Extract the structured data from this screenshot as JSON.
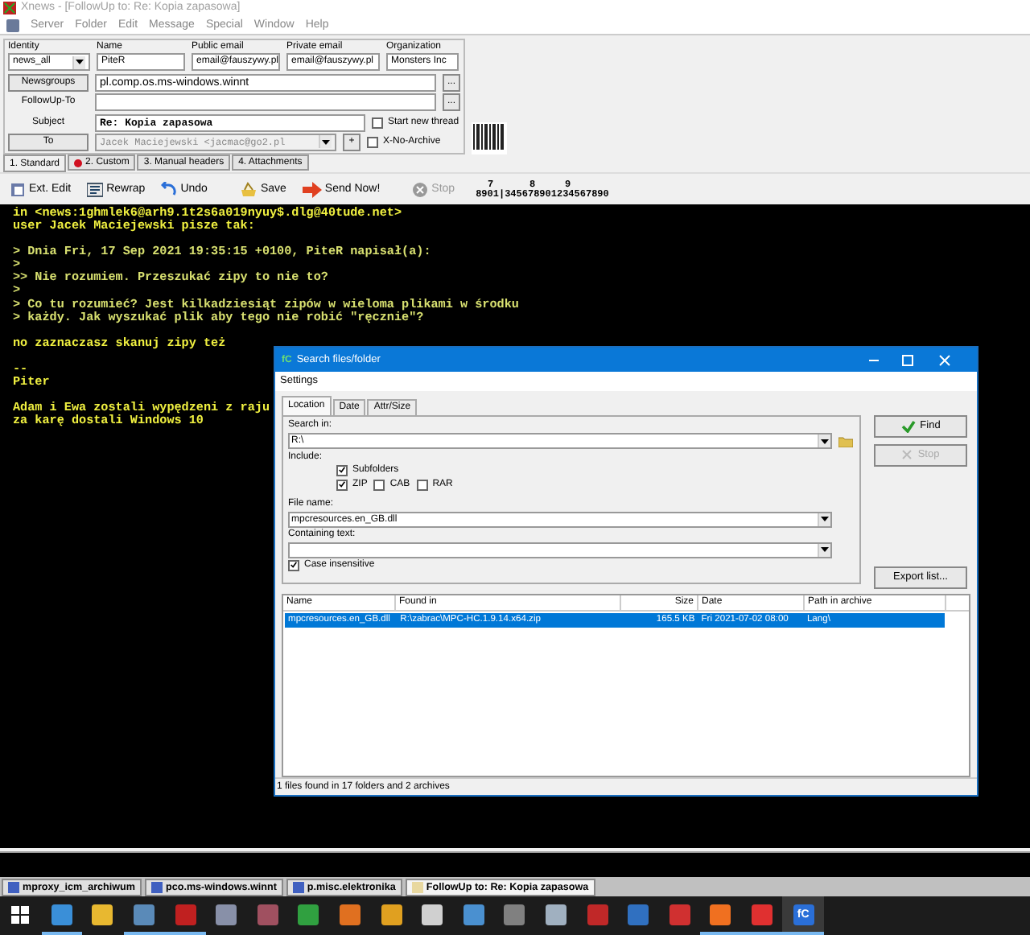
{
  "window": {
    "title": "Xnews - [FollowUp to: Re: Kopia zapasowa]"
  },
  "menu": [
    "Server",
    "Folder",
    "Edit",
    "Message",
    "Special",
    "Window",
    "Help"
  ],
  "header": {
    "labels": [
      "Identity",
      "Name",
      "Public email",
      "Private email",
      "Organization"
    ],
    "identity": "news_all",
    "name": "PiteR",
    "public_email": "email@fauszywy.pl",
    "private_email": "email@fauszywy.pl",
    "organization": "Monsters Inc",
    "newsgroups_button": "Newsgroups",
    "newsgroups": "pl.comp.os.ms-windows.winnt",
    "browse_button": "...",
    "followup_label": "FollowUp-To",
    "subject_label": "Subject",
    "subject": "Re: Kopia zapasowa",
    "to_button": "To",
    "to": "Jacek Maciejewski <jacmac@go2.pl",
    "add_button": "+",
    "options": [
      {
        "label": "Start new thread",
        "checked": false
      },
      {
        "label": "X-No-Archive",
        "checked": false
      }
    ]
  },
  "tabs": [
    {
      "label": "1. Standard",
      "selected": true,
      "dot": false
    },
    {
      "label": "2. Custom",
      "selected": false,
      "dot": true
    },
    {
      "label": "3. Manual headers",
      "selected": false,
      "dot": false
    },
    {
      "label": "4. Attachments",
      "selected": false,
      "dot": false
    }
  ],
  "toolbar": [
    {
      "label": "Ext. Edit",
      "kind": "edit",
      "disabled": false
    },
    {
      "label": "Rewrap",
      "kind": "rewrap",
      "disabled": false
    },
    {
      "label": "Undo",
      "kind": "undo",
      "disabled": false
    },
    {
      "label": "Save",
      "kind": "save",
      "disabled": false
    },
    {
      "label": "Send Now!",
      "kind": "send",
      "disabled": false
    },
    {
      "label": "Stop",
      "kind": "stop",
      "disabled": true
    }
  ],
  "ruler": {
    "tens": [
      "7",
      "8",
      "9"
    ],
    "digits": "8901|345678901234567890"
  },
  "editor": [
    [
      {
        "text": "in <news:1ghmlek6@arh9.1t2s6a019nyuy$.dlg@40tude.net>",
        "kind": "text"
      },
      {
        "text": "user Jacek Maciejewski pisze tak:",
        "kind": "text"
      }
    ],
    [
      {
        "text": "> Dnia Fri, 17 Sep 2021 19:35:15 +0100, PiteR napisał(a):",
        "kind": "quote"
      },
      {
        "text": ">",
        "kind": "quote"
      },
      {
        "text": ">> Nie rozumiem. Przeszukać zipy to nie to?",
        "kind": "quote"
      },
      {
        "text": ">",
        "kind": "quote"
      },
      {
        "text": "> Co tu rozumieć? Jest kilkadziesiąt zipów w wieloma plikami w środku",
        "kind": "quote"
      },
      {
        "text": "> każdy. Jak wyszukać plik aby tego nie robić \"ręcznie\"?",
        "kind": "quote"
      }
    ],
    [
      {
        "text": "no zaznaczasz skanuj zipy też",
        "kind": "text"
      }
    ],
    [
      {
        "text": "--",
        "kind": "text"
      },
      {
        "text": "Piter",
        "kind": "text"
      }
    ],
    [
      {
        "text": "Adam i Ewa zostali wypędzeni z raju",
        "kind": "text"
      },
      {
        "text": "za karę dostali Windows 10",
        "kind": "text"
      }
    ]
  ],
  "dialog": {
    "title": "Search files/folder",
    "app_badge": "fC",
    "menu": [
      "Settings"
    ],
    "tabs": [
      {
        "label": "Location",
        "selected": true
      },
      {
        "label": "Date",
        "selected": false
      },
      {
        "label": "Attr/Size",
        "selected": false
      }
    ],
    "search_in_label": "Search in:",
    "search_in": "R:\\",
    "include_label": "Include:",
    "subfolders": {
      "label": "Subfolders",
      "checked": true
    },
    "archives": [
      {
        "label": "ZIP",
        "checked": true
      },
      {
        "label": "CAB",
        "checked": false
      },
      {
        "label": "RAR",
        "checked": false
      }
    ],
    "file_name_label": "File name:",
    "file_name": "mpcresources.en_GB.dll",
    "containing_label": "Containing text:",
    "case_insensitive": {
      "label": "Case insensitive",
      "checked": true
    },
    "buttons": [
      {
        "label": "Find",
        "kind": "find",
        "disabled": false
      },
      {
        "label": "Stop",
        "kind": "stop",
        "disabled": true
      }
    ],
    "export_button": "Export list...",
    "columns": [
      "Name",
      "Found in",
      "Size",
      "Date",
      "Path in archive"
    ],
    "rows": [
      {
        "cells": [
          "mpcresources.en_GB.dll",
          "R:\\zabrac\\MPC-HC.1.9.14.x64.zip",
          "165.5 KB",
          "Fri 2021-07-02 08:00",
          "Lang\\"
        ],
        "selected": true
      }
    ],
    "status": "1 files found in 17 folders and 2 archives"
  },
  "mdi_tabs": [
    {
      "label": "mproxy_icm_archiwum",
      "selected": false
    },
    {
      "label": "pco.ms-windows.winnt",
      "selected": false
    },
    {
      "label": "p.misc.elektronika",
      "selected": false
    },
    {
      "label": "FollowUp to: Re: Kopia zapasowa",
      "selected": true
    }
  ],
  "taskbar": [
    {
      "color": "#3a8fd8",
      "running": true,
      "selected": false
    },
    {
      "color": "#e8b830",
      "running": false,
      "selected": false
    },
    {
      "color": "#5a8ab8",
      "running": true,
      "selected": false
    },
    {
      "color": "#c02020",
      "running": true,
      "selected": false
    },
    {
      "color": "#8890a8",
      "running": false,
      "selected": false
    },
    {
      "color": "#a05060",
      "running": false,
      "selected": false
    },
    {
      "color": "#30a040",
      "running": false,
      "selected": false
    },
    {
      "color": "#e07020",
      "running": false,
      "selected": false
    },
    {
      "color": "#e0a020",
      "running": false,
      "selected": false
    },
    {
      "color": "#d0d0d0",
      "running": false,
      "selected": false
    },
    {
      "color": "#4a90d0",
      "running": false,
      "selected": false
    },
    {
      "color": "#808080",
      "running": false,
      "selected": false
    },
    {
      "color": "#a0b0c0",
      "running": false,
      "selected": false
    },
    {
      "color": "#c02828",
      "running": false,
      "selected": false
    },
    {
      "color": "#3070c0",
      "running": false,
      "selected": false
    },
    {
      "color": "#d03030",
      "running": false,
      "selected": false
    },
    {
      "color": "#f07020",
      "running": true,
      "selected": false
    },
    {
      "color": "#e03030",
      "running": true,
      "selected": false
    },
    {
      "color": "#2a6fd8",
      "running": true,
      "selected": true,
      "label": "fC"
    }
  ]
}
